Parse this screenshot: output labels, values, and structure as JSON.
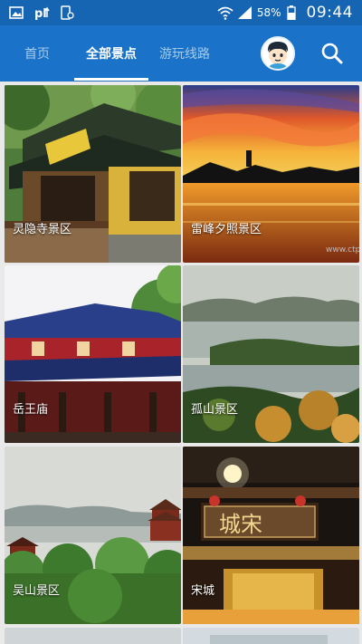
{
  "status_bar": {
    "battery": "58%",
    "time": "09:44",
    "icons": [
      "image-icon",
      "pl-icon",
      "phone-settings-icon",
      "wifi-icon",
      "signal-icon",
      "battery-icon"
    ]
  },
  "tabs": [
    {
      "label": "首页"
    },
    {
      "label": "全部景点"
    },
    {
      "label": "游玩线路"
    }
  ],
  "active_tab": 1,
  "attractions": [
    {
      "name": "灵隐寺景区"
    },
    {
      "name": "雷峰夕照景区"
    },
    {
      "name": "岳王庙"
    },
    {
      "name": "孤山景区"
    },
    {
      "name": "吴山景区"
    },
    {
      "name": "宋城"
    }
  ],
  "colors": {
    "status_bar": "#1565b3",
    "app_bar": "#1a73c8",
    "background": "#e9e9e9"
  }
}
